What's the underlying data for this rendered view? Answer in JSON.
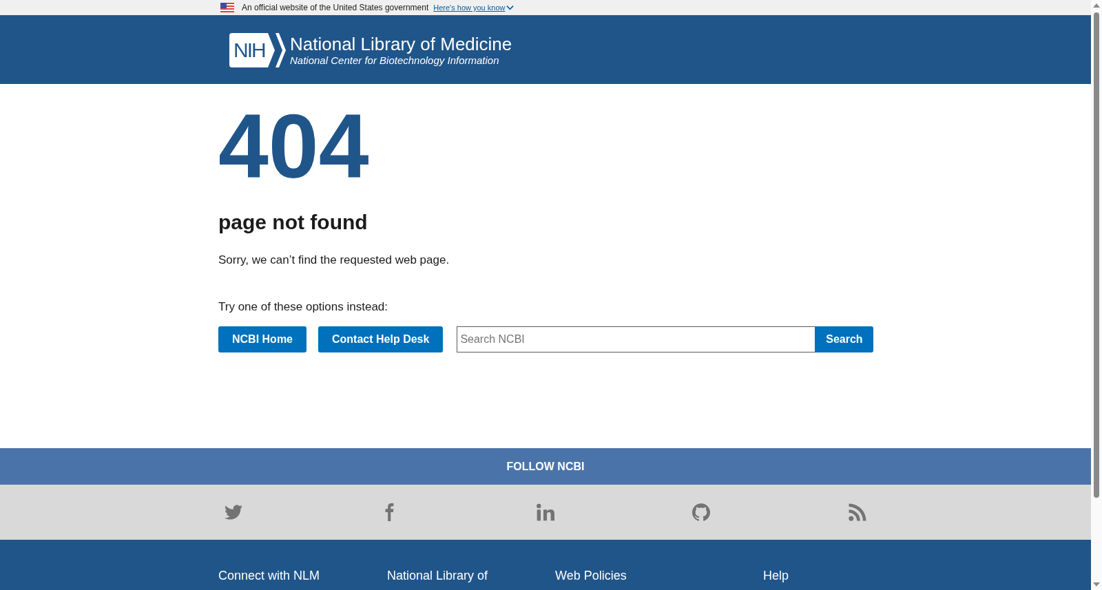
{
  "gov_banner": {
    "text": "An official website of the United States government",
    "link": "Here's how you know"
  },
  "header": {
    "logo_badge": "NIH",
    "title": "National Library of Medicine",
    "subtitle": "National Center for Biotechnology Information"
  },
  "error": {
    "code": "404",
    "heading": "page not found",
    "message": "Sorry, we can’t find the requested web page.",
    "prompt": "Try one of these options instead:"
  },
  "actions": {
    "buttons": [
      "NCBI Home",
      "Contact Help Desk"
    ],
    "search": {
      "placeholder": "Search NCBI",
      "button": "Search"
    }
  },
  "follow": {
    "title": "FOLLOW NCBI"
  },
  "footer": {
    "columns": [
      "Connect with NLM",
      "National Library of",
      "Web Policies",
      "Help"
    ]
  }
}
